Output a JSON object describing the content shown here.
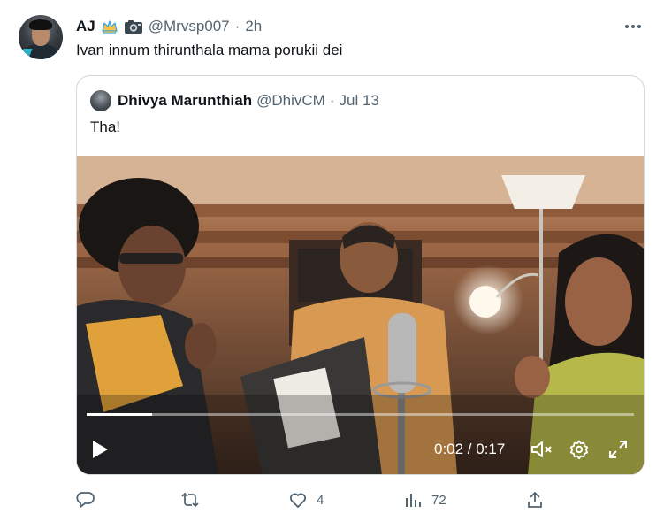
{
  "tweet": {
    "author_name": "AJ",
    "handle": "@Mrvsp007",
    "separator": "·",
    "time": "2h",
    "text": "Ivan innum thirunthala mama porukii dei"
  },
  "quoted_tweet": {
    "author_name": "Dhivya Marunthiah",
    "handle": "@DhivCM",
    "separator": "·",
    "date": "Jul 13",
    "text": "Tha!"
  },
  "video": {
    "timecode": "0:02 / 0:17",
    "progress": 0.025,
    "playing": false,
    "muted": true
  },
  "actions": {
    "reply_count": "",
    "retweet_count": "",
    "like_count": "4",
    "views_count": "72"
  },
  "icons": {
    "header": [
      "crown-icon",
      "camera-icon",
      "more-icon"
    ],
    "video": [
      "play-icon",
      "mute-icon",
      "settings-icon",
      "fullscreen-icon"
    ],
    "actions": [
      "reply-icon",
      "retweet-icon",
      "like-icon",
      "views-icon",
      "share-icon"
    ]
  },
  "colors": {
    "text": "#0f1419",
    "secondary": "#536471",
    "border": "#cfd9de",
    "crown": "#f4b400",
    "crown_outline": "#1d9bf0"
  }
}
